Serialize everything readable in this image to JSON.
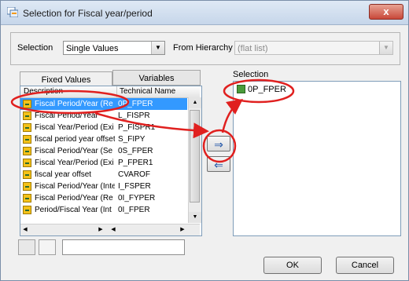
{
  "window": {
    "title": "Selection for Fiscal year/period",
    "close_label": "x"
  },
  "top": {
    "selection_label": "Selection",
    "selection_value": "Single Values",
    "hierarchy_label": "From Hierarchy",
    "hierarchy_value": "(flat list)"
  },
  "tabs": {
    "fixed": "Fixed Values",
    "variables": "Variables"
  },
  "list": {
    "columns": [
      "Description",
      "Technical Name"
    ],
    "rows": [
      {
        "desc": "Fiscal Period/Year (Re",
        "tech": "0P_FPER",
        "selected": true
      },
      {
        "desc": "Fiscal Period/Year",
        "tech": "L_FISPR"
      },
      {
        "desc": "Fiscal Year/Period (Exi",
        "tech": "P_FISPR1"
      },
      {
        "desc": "fiscal period year offset",
        "tech": "S_FIPY"
      },
      {
        "desc": "Fiscal Period/Year (Se",
        "tech": "0S_FPER"
      },
      {
        "desc": "Fiscal Year/Period (Exi",
        "tech": "P_FPER1"
      },
      {
        "desc": "fiscal year offset",
        "tech": "CVAROF"
      },
      {
        "desc": "Fiscal Period/Year (Inte",
        "tech": "I_FSPER"
      },
      {
        "desc": "Fiscal Period/Year (Re",
        "tech": "0I_FYPER"
      },
      {
        "desc": "Period/Fiscal Year (Int",
        "tech": "0I_FPER"
      }
    ]
  },
  "selection": {
    "label": "Selection",
    "items": [
      "0P_FPER"
    ]
  },
  "buttons": {
    "add": "⇒",
    "remove": "⇐",
    "ok": "OK",
    "cancel": "Cancel"
  },
  "colors": {
    "annotation": "#e0201f",
    "selected_row": "#3399ff"
  },
  "icons": {
    "variable": "variable-icon",
    "selection": "selection-item-icon"
  }
}
